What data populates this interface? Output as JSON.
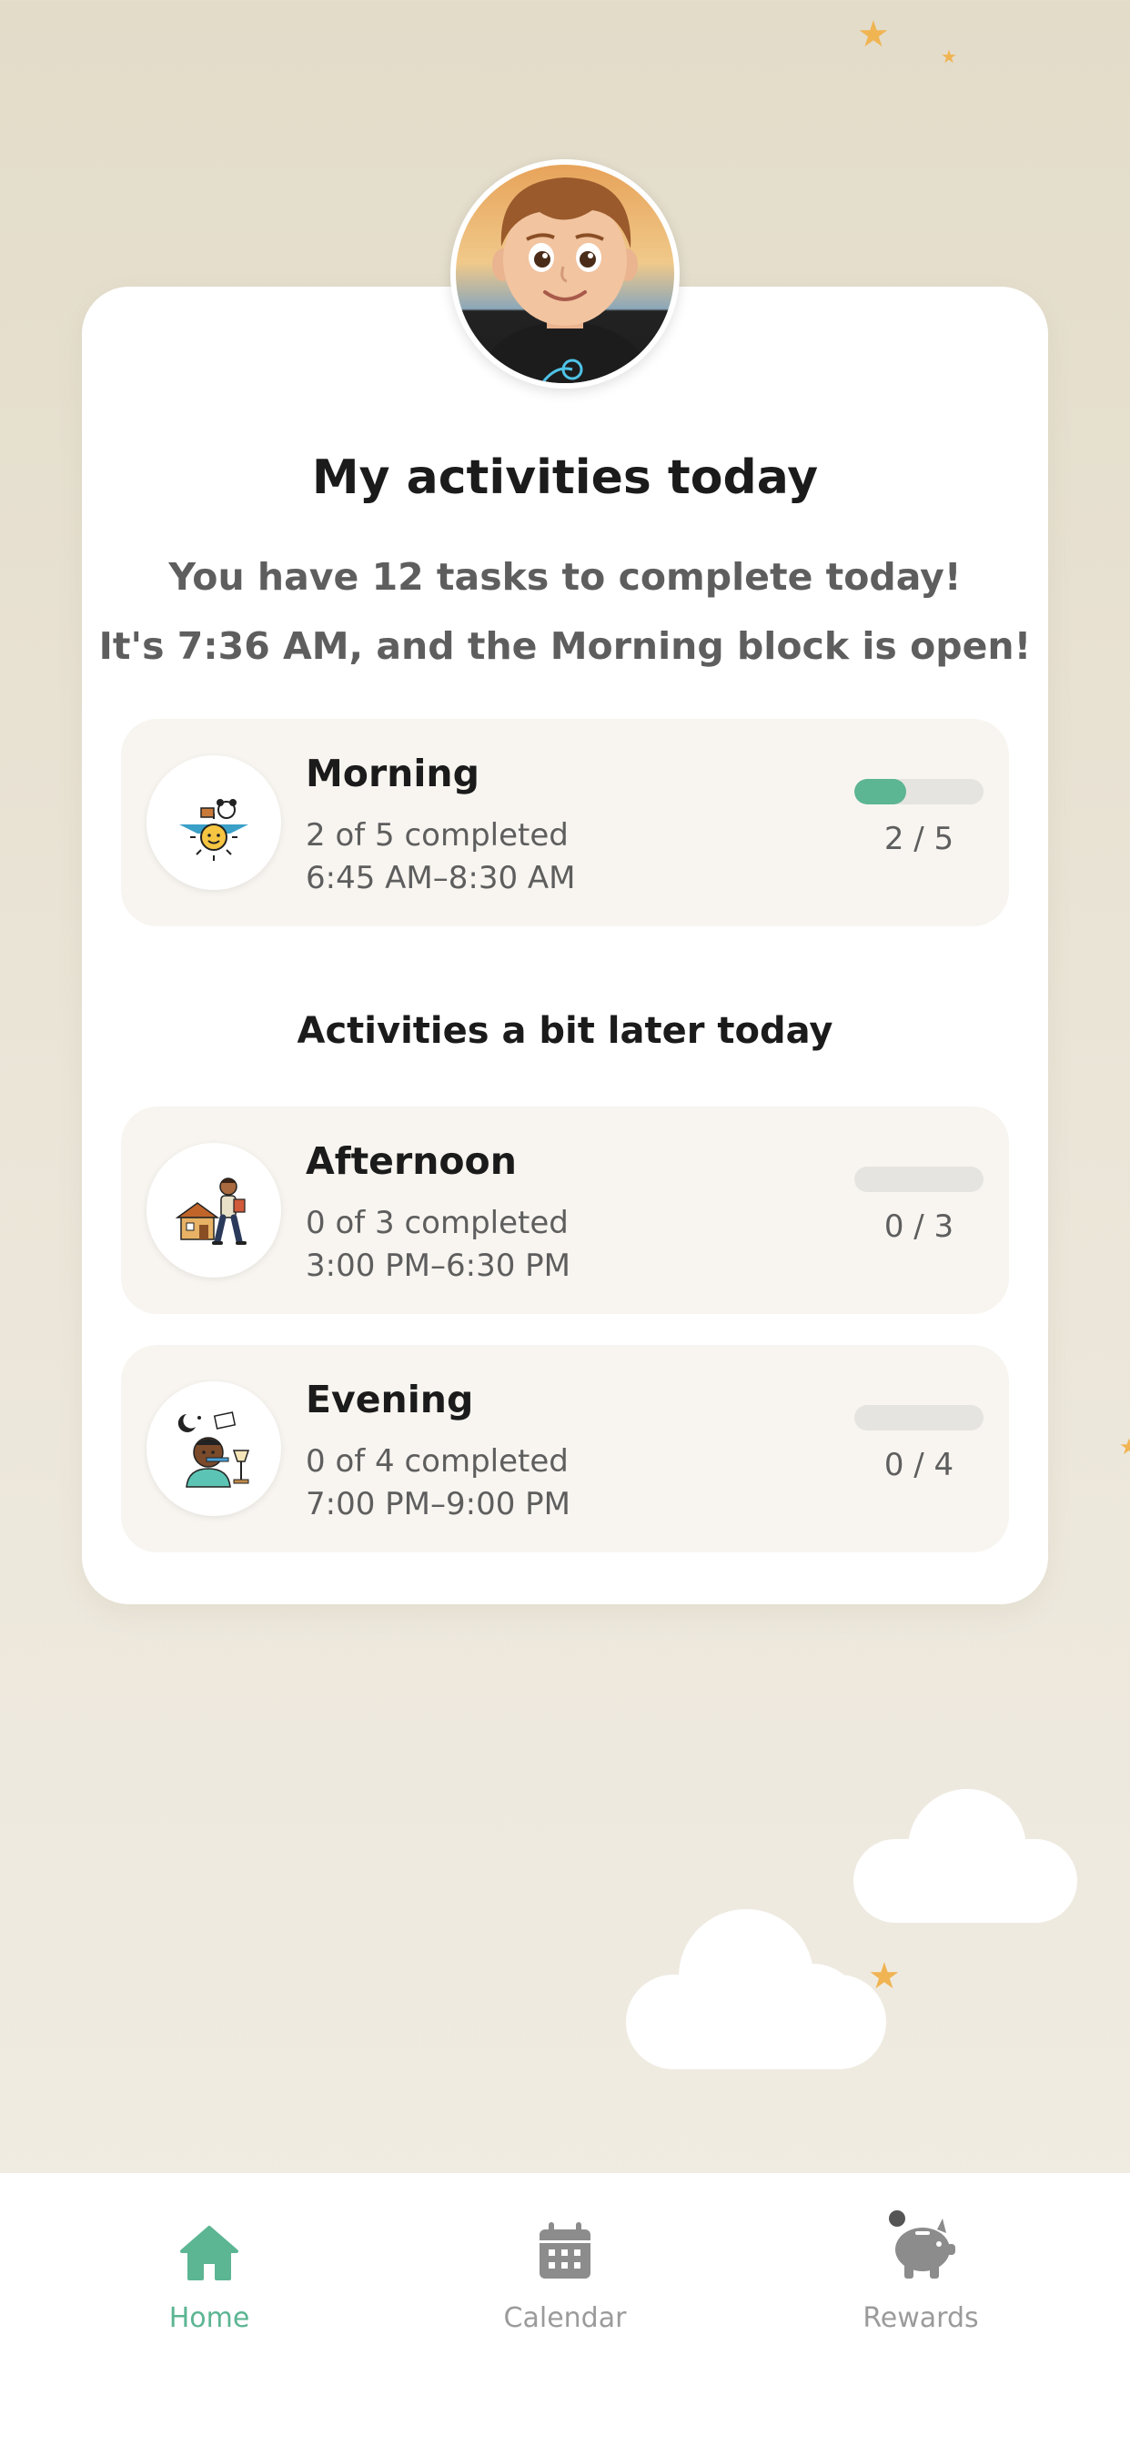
{
  "header": {
    "title": "My activities today",
    "summary": "You have 12 tasks to complete today!",
    "status": "It's 7:36 AM, and the Morning block is open!"
  },
  "current_block": {
    "name": "Morning",
    "completed_text": "2 of 5 completed",
    "time_range": "6:45 AM–8:30 AM",
    "count_text": "2 / 5",
    "progress": 0.4,
    "icon": "morning-sun-icon"
  },
  "later_section": {
    "title": "Activities a bit later today",
    "blocks": [
      {
        "name": "Afternoon",
        "completed_text": "0 of 3 completed",
        "time_range": "3:00 PM–6:30 PM",
        "count_text": "0 / 3",
        "progress": 0,
        "icon": "afternoon-walk-icon"
      },
      {
        "name": "Evening",
        "completed_text": "0 of 4 completed",
        "time_range": "7:00 PM–9:00 PM",
        "count_text": "0 / 4",
        "progress": 0,
        "icon": "evening-toothbrush-icon"
      }
    ]
  },
  "nav": {
    "home": "Home",
    "calendar": "Calendar",
    "rewards": "Rewards"
  },
  "colors": {
    "accent": "#5cb593",
    "inactive": "#9b9b9b",
    "background": "#ebe5d8"
  }
}
